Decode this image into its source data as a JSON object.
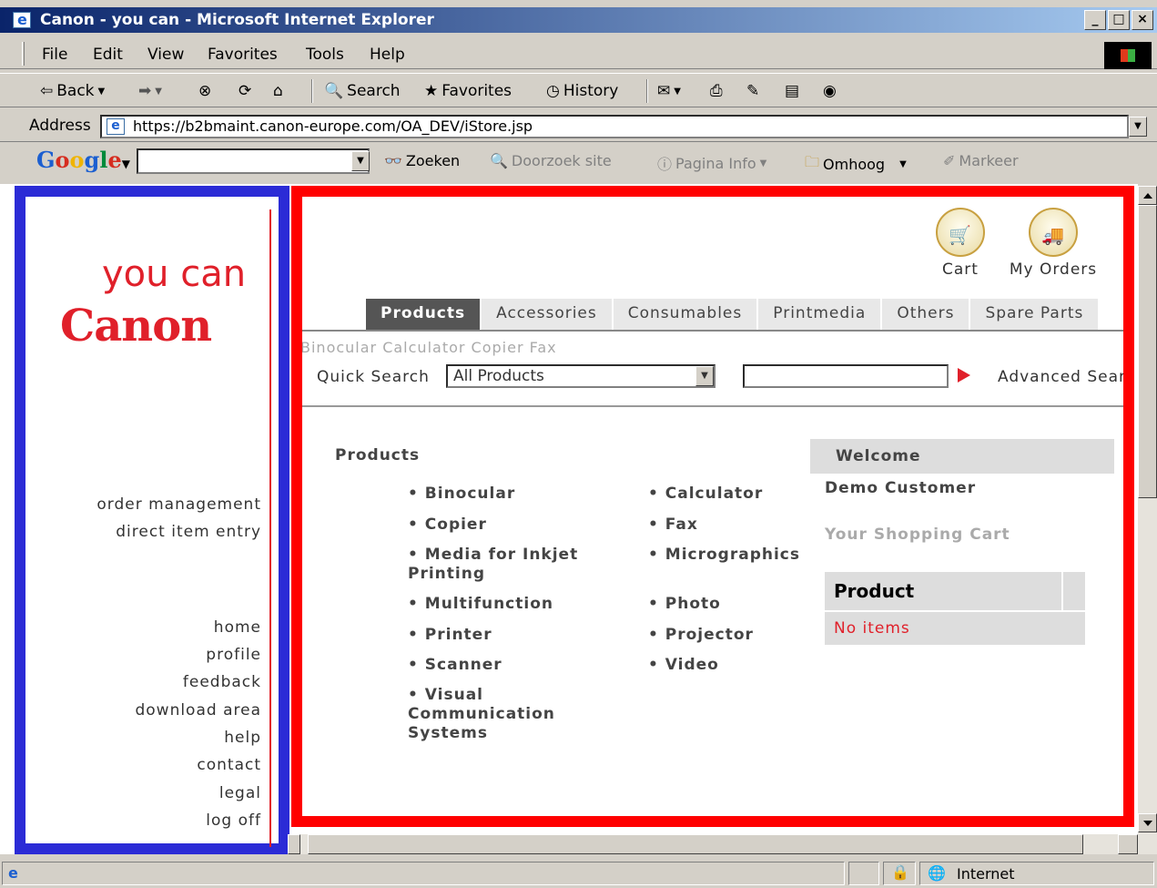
{
  "window": {
    "title": "Canon - you can - Microsoft Internet Explorer"
  },
  "menu": [
    "File",
    "Edit",
    "View",
    "Favorites",
    "Tools",
    "Help"
  ],
  "toolbar": {
    "back": "Back",
    "search": "Search",
    "favorites": "Favorites",
    "history": "History"
  },
  "address": {
    "label": "Address",
    "url": "https://b2bmaint.canon-europe.com/OA_DEV/iStore.jsp"
  },
  "google": {
    "zoeken": "Zoeken",
    "doorzoek": "Doorzoek site",
    "pagina": "Pagina Info",
    "omhoog": "Omhoog",
    "markeer": "Markeer"
  },
  "sidebar": {
    "youcan": "you can",
    "canon": "Canon",
    "links_top": [
      "order management",
      "direct item entry"
    ],
    "links_bottom": [
      "home",
      "profile",
      "feedback",
      "download area",
      "help",
      "contact",
      "legal",
      "log off"
    ]
  },
  "header": {
    "cart": "Cart",
    "orders": "My Orders"
  },
  "tabs": [
    "Products",
    "Accessories",
    "Consumables",
    "Printmedia",
    "Others",
    "Spare Parts"
  ],
  "subcategories": "Binocular Calculator Copier Fax",
  "quicksearch": {
    "label": "Quick Search",
    "selected": "All Products",
    "input_value": "",
    "advanced": "Advanced Search"
  },
  "products": {
    "heading": "Products",
    "col1": [
      "• Binocular",
      "• Copier",
      "• Media for Inkjet Printing",
      "• Multifunction",
      "• Printer",
      "• Scanner",
      "• Visual Communication Systems"
    ],
    "col2": [
      "• Calculator",
      "• Fax",
      "• Micrographics",
      "• Photo",
      "• Projector",
      "• Video"
    ]
  },
  "welcome": {
    "title": "Welcome",
    "customer": "Demo Customer",
    "cart_title": "Your Shopping Cart",
    "col_product": "Product",
    "empty": "No items"
  },
  "status": {
    "zone": "Internet"
  },
  "colors": {
    "highlight_blue": "#2b2bd6",
    "highlight_red": "#ff0000",
    "canon_red": "#e0202a"
  }
}
